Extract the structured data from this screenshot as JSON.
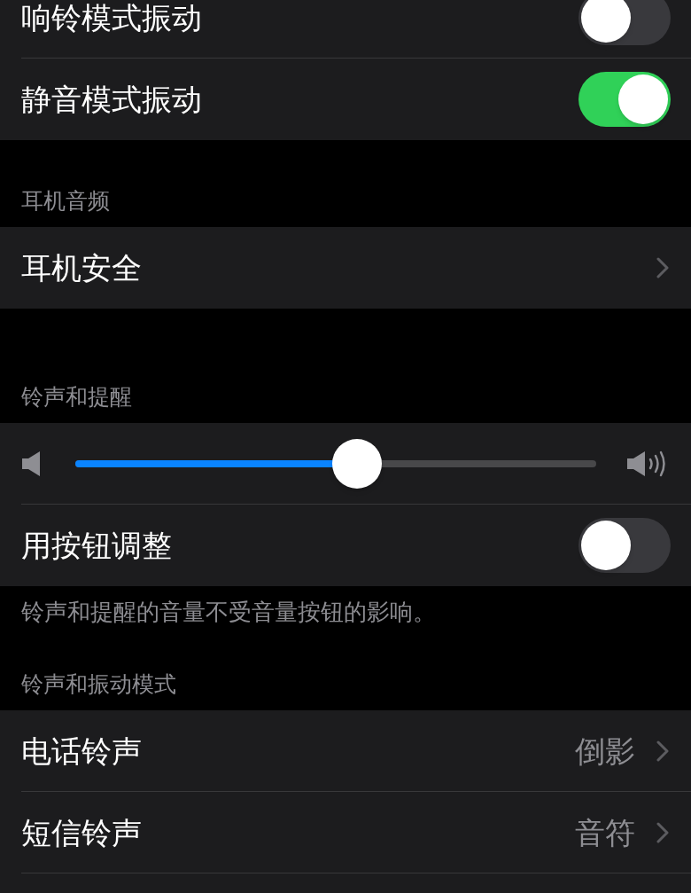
{
  "groups": [
    {
      "rows": [
        {
          "kind": "toggle",
          "label": "响铃模式振动",
          "on": false
        },
        {
          "kind": "toggle",
          "label": "静音模式振动",
          "on": true
        }
      ]
    },
    {
      "header": "耳机音频",
      "rows": [
        {
          "kind": "link",
          "label": "耳机安全"
        }
      ]
    },
    {
      "header": "铃声和提醒",
      "rows": [
        {
          "kind": "slider",
          "level": 0.54
        },
        {
          "kind": "toggle",
          "label": "用按钮调整",
          "on": false
        }
      ],
      "footer": "铃声和提醒的音量不受音量按钮的影响。"
    },
    {
      "header": "铃声和振动模式",
      "rows": [
        {
          "kind": "link",
          "label": "电话铃声",
          "value": "倒影"
        },
        {
          "kind": "link",
          "label": "短信铃声",
          "value": "音符"
        },
        {
          "kind": "blank"
        }
      ]
    }
  ]
}
